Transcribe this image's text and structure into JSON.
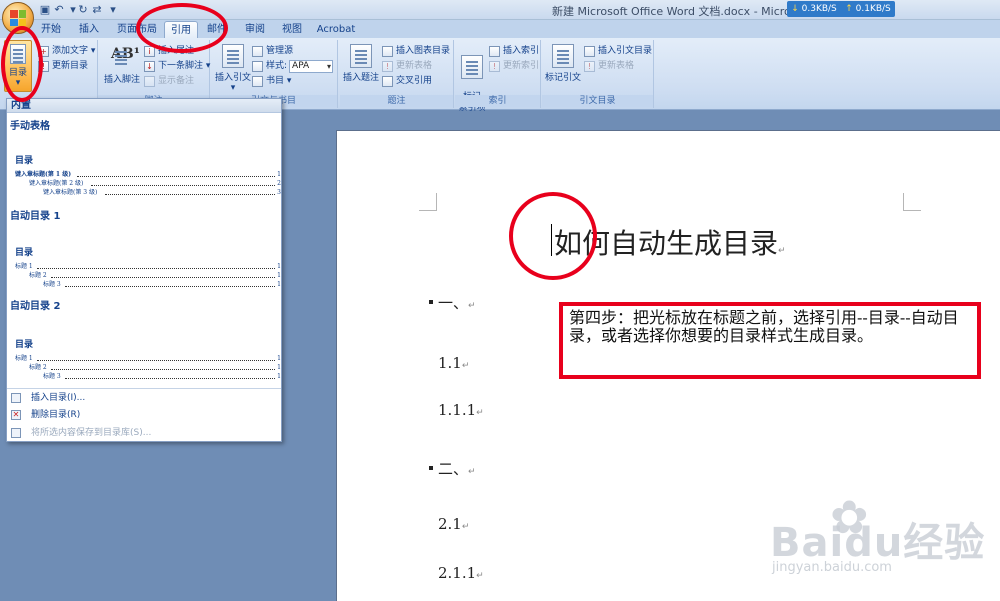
{
  "titlebar": {
    "title": "新建 Microsoft Office Word 文档.docx - Microsoft Wo",
    "net_down": "0.3KB/S",
    "net_up": "0.1KB/S"
  },
  "tabs": [
    {
      "label": "开始"
    },
    {
      "label": "插入"
    },
    {
      "label": "页面布局"
    },
    {
      "label": "引用"
    },
    {
      "label": "邮件"
    },
    {
      "label": "审阅"
    },
    {
      "label": "视图"
    },
    {
      "label": "Acrobat"
    }
  ],
  "ribbon": {
    "toc": {
      "main": "目录",
      "add_text": "添加文字",
      "update_toc": "更新目录"
    },
    "footnotes": {
      "insert_footnote": "插入脚注",
      "insert_endnote": "插入尾注",
      "next_footnote": "下一条脚注",
      "show_notes": "显示备注",
      "group_label": "脚注"
    },
    "citations": {
      "insert_citation": "插入引文",
      "manage_sources": "管理源",
      "style_label": "样式:",
      "style_value": "APA",
      "bibliography": "书目",
      "group_label": "引文与书目"
    },
    "captions": {
      "insert_caption": "插入题注",
      "insert_table_of_figures": "插入图表目录",
      "update_table": "更新表格",
      "cross_reference": "交叉引用",
      "group_label": "题注"
    },
    "index": {
      "mark_entry": "标记\n索引项",
      "insert_index": "插入索引",
      "update_index": "更新索引",
      "group_label": "索引"
    },
    "toa": {
      "mark_citation": "标记引文",
      "insert_toa": "插入引文目录",
      "update_table": "更新表格",
      "group_label": "引文目录"
    }
  },
  "dropdown": {
    "header": "内置",
    "galleries": [
      {
        "name": "手动表格",
        "preview_title": "目录",
        "lines": [
          {
            "text": "键入章标题(第 1 级)",
            "num": "1",
            "indent": 0
          },
          {
            "text": "键入章标题(第 2 级)",
            "num": "2",
            "indent": 1
          },
          {
            "text": "键入章标题(第 3 级)",
            "num": "3",
            "indent": 2
          }
        ]
      },
      {
        "name": "自动目录 1",
        "preview_title": "目录",
        "lines": [
          {
            "text": "标题 1",
            "num": "1",
            "indent": 0
          },
          {
            "text": "标题 2",
            "num": "1",
            "indent": 1
          },
          {
            "text": "标题 3",
            "num": "1",
            "indent": 2
          }
        ]
      },
      {
        "name": "自动目录 2",
        "preview_title": "目录",
        "lines": [
          {
            "text": "标题 1",
            "num": "1",
            "indent": 0
          },
          {
            "text": "标题 2",
            "num": "1",
            "indent": 1
          },
          {
            "text": "标题 3",
            "num": "1",
            "indent": 2
          }
        ]
      }
    ],
    "menu": [
      {
        "label": "插入目录(I)...",
        "disabled": false
      },
      {
        "label": "删除目录(R)",
        "disabled": false
      },
      {
        "label": "将所选内容保存到目录库(S)...",
        "disabled": true
      }
    ]
  },
  "document": {
    "title": "如何自动生成目录",
    "headings": [
      {
        "text": "一、",
        "bullet": true
      },
      {
        "text": "1.1",
        "bullet": false
      },
      {
        "text": "1.1.1",
        "bullet": false
      },
      {
        "text": "二、",
        "bullet": true
      },
      {
        "text": "2.1",
        "bullet": false
      },
      {
        "text": "2.1.1",
        "bullet": false
      }
    ],
    "para_mark": "↵",
    "instruction": "第四步：把光标放在标题之前，选择引用--目录--自动目录，或者选择你想要的目录样式生成目录。"
  },
  "watermark": {
    "big": "Baidu经验",
    "small": "jingyan.baidu.com"
  },
  "colors": {
    "annotation_red": "#e8001c",
    "ribbon_text": "#15428b",
    "workspace": "#6f8db5"
  }
}
